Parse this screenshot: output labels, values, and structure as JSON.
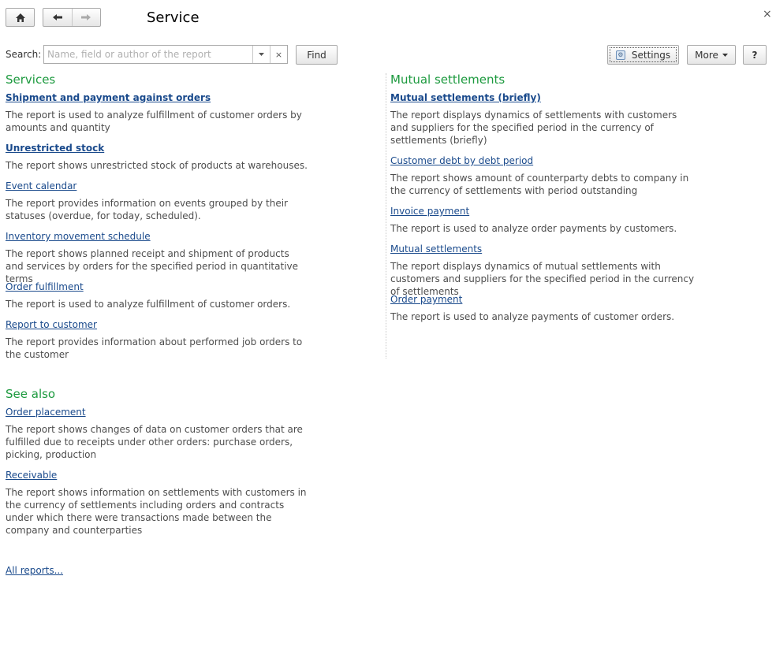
{
  "header": {
    "title": "Service",
    "close_glyph": "×"
  },
  "search": {
    "label": "Search:",
    "placeholder": "Name, field or author of the report",
    "value": "",
    "clear_glyph": "×",
    "find_label": "Find"
  },
  "toolbar": {
    "settings_label": "Settings",
    "more_label": "More",
    "help_label": "?"
  },
  "services": {
    "heading": "Services",
    "items": [
      {
        "title": "Shipment and payment against orders",
        "bold": true,
        "desc": "The report is used to analyze fulfillment of customer orders by amounts and quantity"
      },
      {
        "title": "Unrestricted stock",
        "bold": true,
        "desc": "The report shows unrestricted stock of products at warehouses."
      },
      {
        "title": "Event calendar",
        "bold": false,
        "desc": "The report provides information on events grouped by their statuses (overdue, for today, scheduled)."
      },
      {
        "title": "Inventory movement schedule",
        "bold": false,
        "desc": "The report shows planned receipt and shipment of products and services by orders for the specified period in quantitative terms"
      },
      {
        "title": "Order fulfillment",
        "bold": false,
        "desc": "The report is used to analyze fulfillment of customer orders."
      },
      {
        "title": "Report to customer",
        "bold": false,
        "desc": "The report provides information about performed job orders to the customer"
      }
    ]
  },
  "mutual": {
    "heading": "Mutual settlements",
    "items": [
      {
        "title": "Mutual settlements (briefly)",
        "bold": true,
        "desc": "The report displays dynamics of settlements with customers and suppliers for the specified period in the currency of settlements (briefly)"
      },
      {
        "title": "Customer debt by debt period",
        "bold": false,
        "desc": "The report shows amount of counterparty debts to company in the currency of settlements with period outstanding"
      },
      {
        "title": "Invoice payment",
        "bold": false,
        "desc": "The report is used to analyze order payments by customers."
      },
      {
        "title": "Mutual settlements",
        "bold": false,
        "desc": "The report displays dynamics of mutual settlements with customers and suppliers for the specified period in the currency of settlements"
      },
      {
        "title": "Order payment",
        "bold": false,
        "desc": "The report is used to analyze payments of customer orders."
      }
    ]
  },
  "see_also": {
    "heading": "See also",
    "items": [
      {
        "title": "Order placement",
        "bold": false,
        "desc": "The report shows changes of data on customer orders that are fulfilled due to receipts under other orders: purchase orders, picking, production"
      },
      {
        "title": "Receivable",
        "bold": false,
        "desc": "The report shows information on settlements with customers in the currency of settlements including orders and contracts under which there were transactions made between the company and counterparties"
      }
    ]
  },
  "all_reports_label": "All reports..."
}
